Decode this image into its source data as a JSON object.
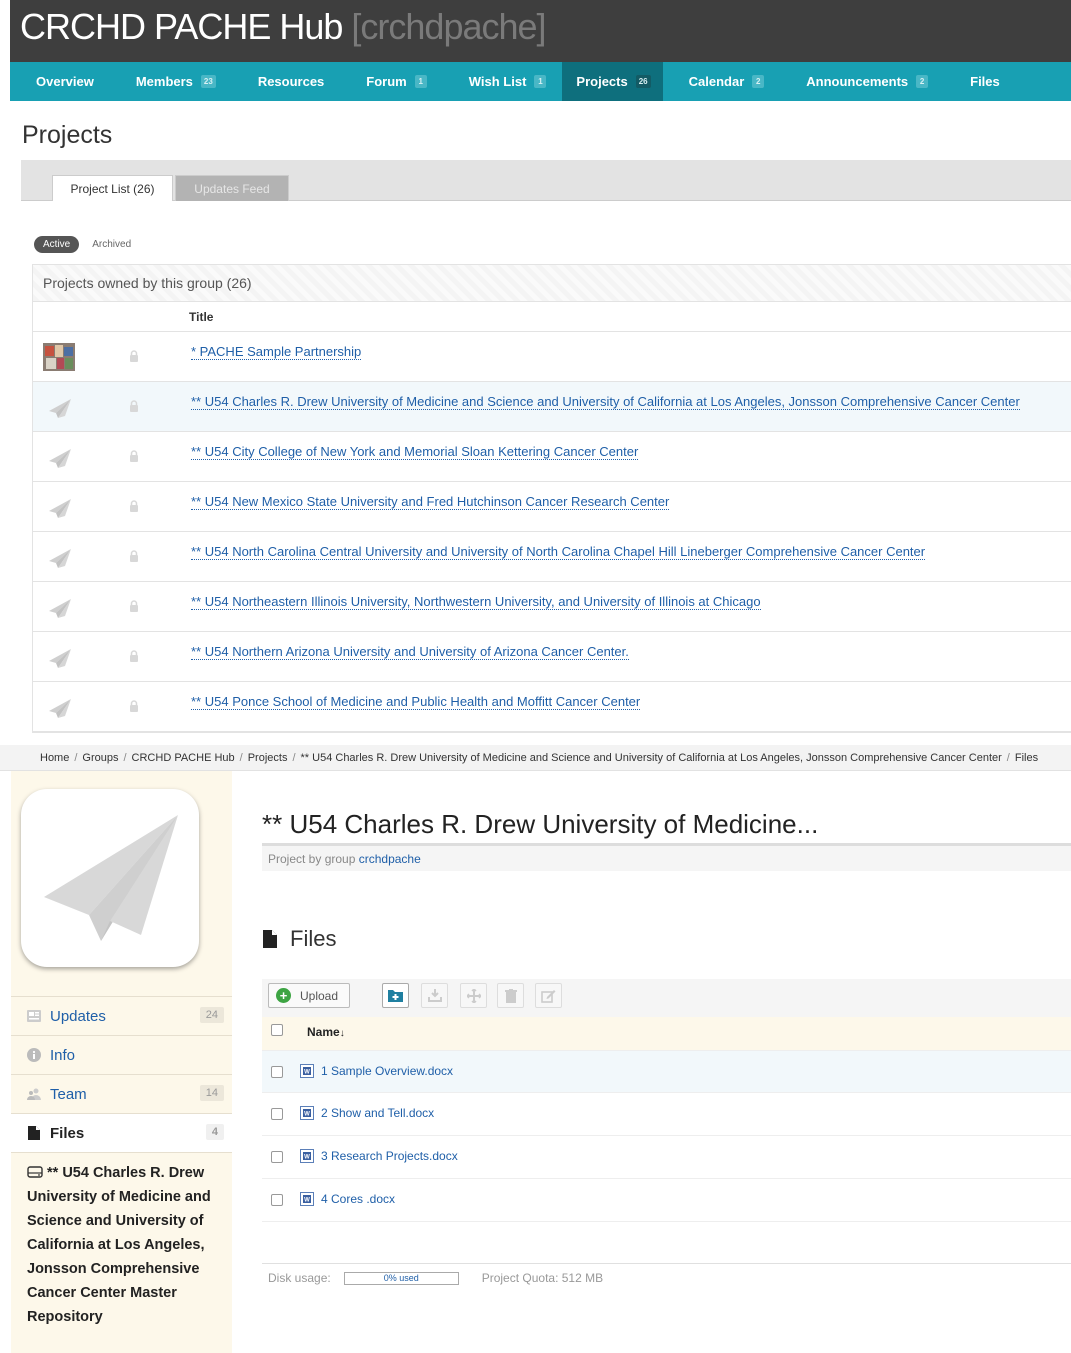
{
  "hub": {
    "title": "CRCHD PACHE Hub",
    "alias": "[crchdpache]",
    "accent_color": "#18a0b3",
    "header_color": "#3e3e3e"
  },
  "group_nav": [
    {
      "label": "Overview",
      "badge": ""
    },
    {
      "label": "Members",
      "badge": "23"
    },
    {
      "label": "Resources",
      "badge": ""
    },
    {
      "label": "Forum",
      "badge": "1"
    },
    {
      "label": "Wish List",
      "badge": "1"
    },
    {
      "label": "Projects",
      "badge": "26",
      "active": true
    },
    {
      "label": "Calendar",
      "badge": "2"
    },
    {
      "label": "Announcements",
      "badge": "2"
    },
    {
      "label": "Files",
      "badge": ""
    }
  ],
  "projects_page": {
    "title": "Projects",
    "tabs": [
      "Project List (26)",
      "Updates Feed"
    ],
    "filter": {
      "active": "Active",
      "archived": "Archived"
    },
    "caption": "Projects owned by this group (26)",
    "column_title": "Title",
    "rows": [
      "* PACHE Sample Partnership",
      "** U54 Charles R. Drew University of Medicine and Science and University of California at Los Angeles, Jonsson Comprehensive Cancer Center",
      "** U54 City College of New York and Memorial Sloan Kettering Cancer Center",
      "** U54 New Mexico State University and Fred Hutchinson Cancer Research Center",
      "** U54 North Carolina Central University and University of North Carolina Chapel Hill Lineberger Comprehensive Cancer Center",
      "** U54 Northeastern Illinois University, Northwestern University, and University of Illinois at Chicago",
      "** U54 Northern Arizona University and University of Arizona Cancer Center.",
      "** U54 Ponce School of Medicine and Public Health and Moffitt Cancer Center"
    ]
  },
  "breadcrumb": [
    "Home",
    "Groups",
    "CRCHD PACHE Hub",
    "Projects",
    "** U54 Charles R. Drew University of Medicine and Science and University of California at Los Angeles, Jonsson Comprehensive Cancer Center",
    "Files"
  ],
  "project": {
    "title": "** U54 Charles R. Drew University of Medicine...",
    "owner_prefix": "Project by group ",
    "owner": "crchdpache",
    "side_menu": [
      {
        "label": "Updates",
        "count": "24",
        "icon": "updates-icon"
      },
      {
        "label": "Info",
        "count": "",
        "icon": "info-icon"
      },
      {
        "label": "Team",
        "count": "14",
        "icon": "team-icon"
      },
      {
        "label": "Files",
        "count": "4",
        "icon": "file-icon",
        "current": true
      }
    ],
    "repository": "** U54 Charles R. Drew University of Medicine and Science and University of California at Los Angeles, Jonsson Comprehensive Cancer Center Master Repository"
  },
  "files": {
    "heading": "Files",
    "upload_label": "Upload",
    "column_name": "Name",
    "sort_indicator": "↓",
    "items": [
      "1 Sample Overview.docx",
      "2 Show and Tell.docx",
      "3 Research Projects.docx",
      "4 Cores .docx"
    ],
    "disk_usage_label": "Disk usage:",
    "disk_used": "0% used",
    "quota": "Project Quota: 512 MB"
  }
}
